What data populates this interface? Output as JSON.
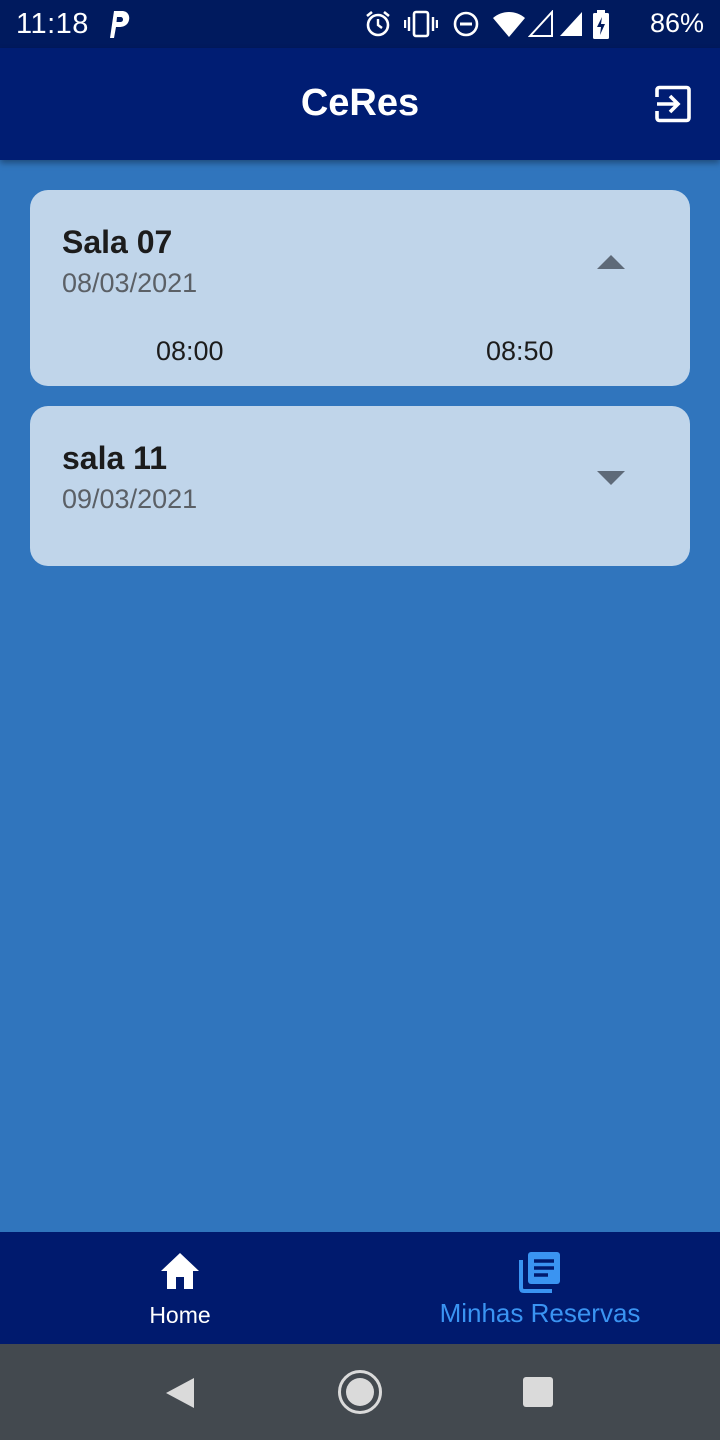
{
  "status_bar": {
    "time": "11:18",
    "battery_percent": "86%",
    "icons": [
      "parking-icon",
      "alarm-icon",
      "vibrate-icon",
      "do-not-disturb-icon",
      "wifi-icon",
      "signal-empty-icon",
      "signal-icon",
      "battery-charging-icon"
    ]
  },
  "app_bar": {
    "title": "CeRes",
    "action_icon": "logout-icon"
  },
  "reservations": [
    {
      "room": "Sala 07",
      "date": "08/03/2021",
      "expanded": true,
      "start_time": "08:00",
      "end_time": "08:50",
      "toggle_icon": "chevron-up-icon"
    },
    {
      "room": "sala 11",
      "date": "09/03/2021",
      "expanded": false,
      "toggle_icon": "chevron-down-icon"
    }
  ],
  "bottom_nav": {
    "items": [
      {
        "label": "Home",
        "icon": "home-icon",
        "active": false
      },
      {
        "label": "Minhas Reservas",
        "icon": "reservations-icon",
        "active": true
      }
    ]
  },
  "colors": {
    "background": "#3075bd",
    "app_bar": "#001d73",
    "card": "#c0d5ea",
    "nav_active": "#3a94f2",
    "bottom_nav": "#001a6e"
  }
}
